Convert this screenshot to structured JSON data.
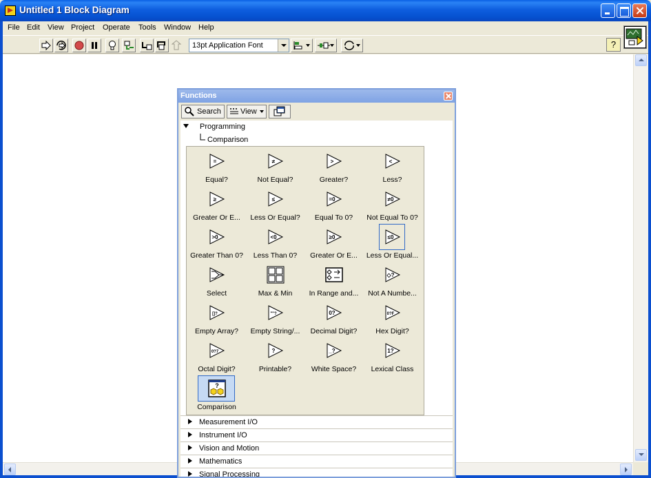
{
  "window": {
    "title": "Untitled 1 Block Diagram"
  },
  "menubar": {
    "items": [
      "File",
      "Edit",
      "View",
      "Project",
      "Operate",
      "Tools",
      "Window",
      "Help"
    ]
  },
  "toolbar": {
    "font_select": "13pt Application Font"
  },
  "palette": {
    "title": "Functions",
    "search_label": "Search",
    "view_label": "View",
    "tree": {
      "parent": "Programming",
      "child": "Comparison"
    },
    "functions": [
      {
        "label": "Equal?",
        "glyph": "="
      },
      {
        "label": "Not Equal?",
        "glyph": "≠"
      },
      {
        "label": "Greater?",
        "glyph": ">"
      },
      {
        "label": "Less?",
        "glyph": "<"
      },
      {
        "label": "Greater Or E...",
        "glyph": "≥"
      },
      {
        "label": "Less Or Equal?",
        "glyph": "≤"
      },
      {
        "label": "Equal To 0?",
        "glyph": "=0"
      },
      {
        "label": "Not Equal To 0?",
        "glyph": "≠0"
      },
      {
        "label": "Greater Than 0?",
        "glyph": ">0"
      },
      {
        "label": "Less Than 0?",
        "glyph": "<0"
      },
      {
        "label": "Greater Or E...",
        "glyph": "≥0"
      },
      {
        "label": "Less Or Equal...",
        "glyph": "≤0"
      },
      {
        "label": "Select",
        "glyph": ""
      },
      {
        "label": "Max & Min",
        "glyph": ""
      },
      {
        "label": "In Range and...",
        "glyph": ""
      },
      {
        "label": "Not A Numbe...",
        "glyph": "◇?"
      },
      {
        "label": "Empty Array?",
        "glyph": "[]?"
      },
      {
        "label": "Empty String/...",
        "glyph": "\"\"?"
      },
      {
        "label": "Decimal Digit?",
        "glyph": "0?"
      },
      {
        "label": "Hex Digit?",
        "glyph": "0?F"
      },
      {
        "label": "Octal Digit?",
        "glyph": "0?7"
      },
      {
        "label": "Printable?",
        "glyph": "?"
      },
      {
        "label": "White Space?",
        "glyph": "_?"
      },
      {
        "label": "Lexical Class",
        "glyph": "1?"
      },
      {
        "label": "Comparison",
        "glyph": "?"
      }
    ],
    "categories": [
      "Measurement I/O",
      "Instrument I/O",
      "Vision and Motion",
      "Mathematics",
      "Signal Processing"
    ]
  }
}
